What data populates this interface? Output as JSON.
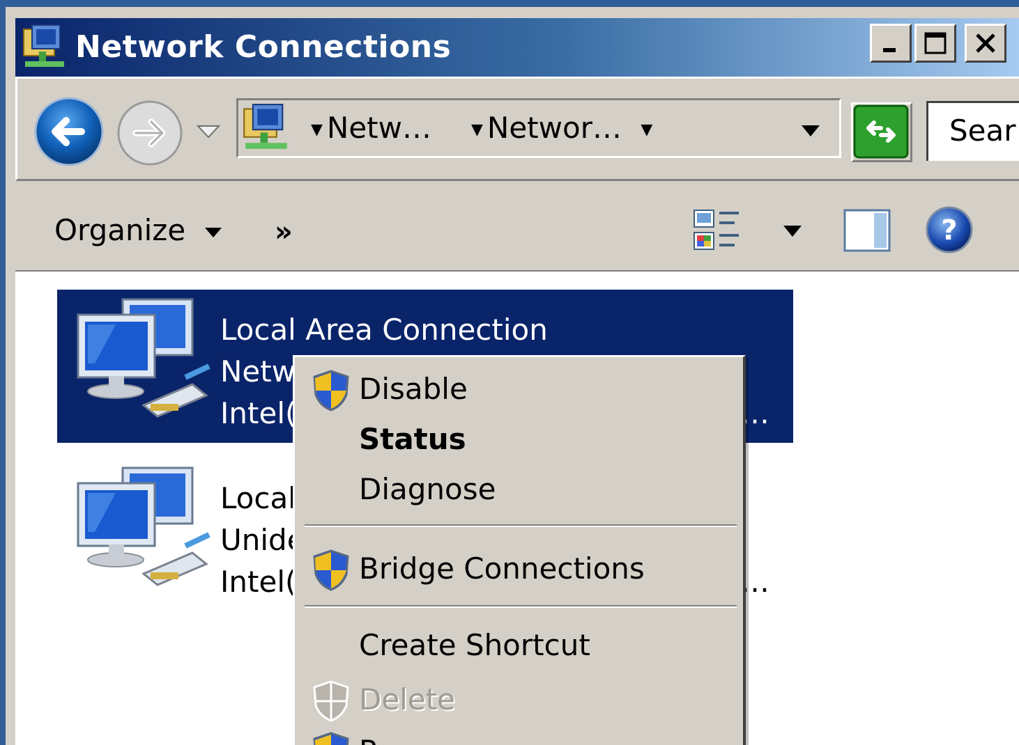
{
  "window": {
    "title": "Network Connections"
  },
  "address_bar": {
    "crumbs": [
      "Netw…",
      "Networ…"
    ],
    "search_placeholder": "Sear"
  },
  "toolbar": {
    "organize_label": "Organize",
    "more_label": "»"
  },
  "connections": [
    {
      "name": "Local Area Connection",
      "status": "Netw",
      "device": "Intel(",
      "truncated": "…",
      "selected": true
    },
    {
      "name": "Local",
      "status": "Unide",
      "device": "Intel(",
      "truncated": "…",
      "selected": false
    }
  ],
  "context_menu": {
    "items": [
      {
        "label": "Disable",
        "icon": "shield-icon",
        "bold": false,
        "enabled": true
      },
      {
        "label": "Status",
        "icon": null,
        "bold": true,
        "enabled": true
      },
      {
        "label": "Diagnose",
        "icon": null,
        "bold": false,
        "enabled": true
      },
      {
        "label": "Bridge Connections",
        "icon": "shield-icon",
        "bold": false,
        "enabled": true
      },
      {
        "label": "Create Shortcut",
        "icon": null,
        "bold": false,
        "enabled": true
      },
      {
        "label": "Delete",
        "icon": "shield-icon",
        "bold": false,
        "enabled": false
      },
      {
        "label": "R",
        "icon": "shield-icon",
        "bold": false,
        "enabled": true
      }
    ]
  },
  "colors": {
    "selection": "#0a246a",
    "title_gradient_start": "#0a246a",
    "title_gradient_end": "#a6caf0",
    "face": "#d4d0c8"
  }
}
